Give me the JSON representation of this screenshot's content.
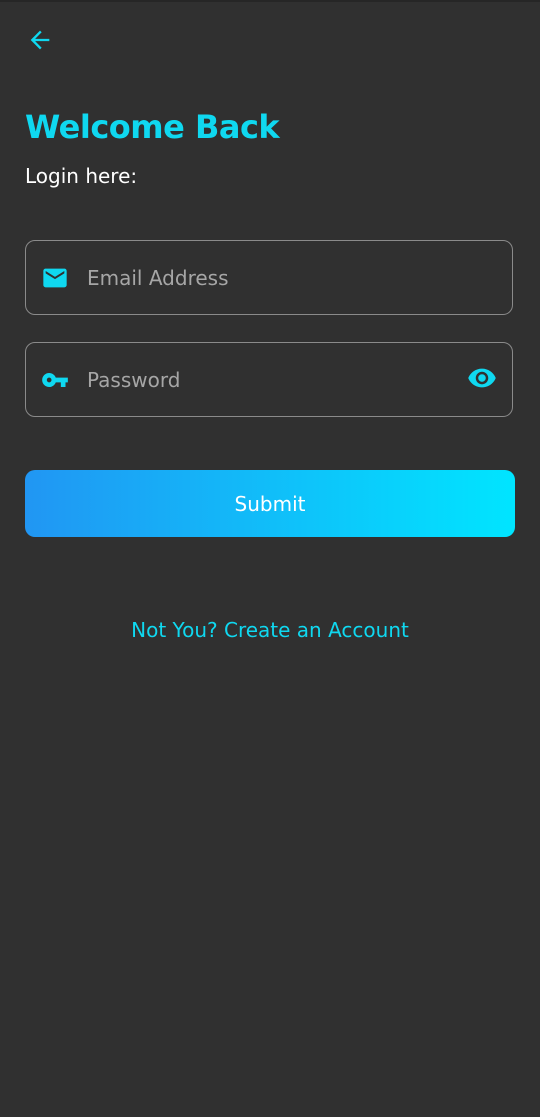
{
  "header": {
    "back_icon": "arrow-left-icon"
  },
  "welcome": {
    "title": "Welcome Back",
    "subtitle": "Login here:"
  },
  "form": {
    "email": {
      "icon": "mail-icon",
      "value": "",
      "placeholder": "Email Address"
    },
    "password": {
      "icon": "key-icon",
      "value": "",
      "placeholder": "Password",
      "toggle_icon": "eye-icon"
    },
    "submit_label": "Submit"
  },
  "footer": {
    "create_account_link": "Not You? Create an Account"
  },
  "colors": {
    "background": "#303030",
    "accent": "#0fd8f0",
    "button_gradient_start": "#2196f3",
    "button_gradient_end": "#00e5ff",
    "field_border": "#8a8a8a",
    "placeholder": "#a6a6a6"
  }
}
